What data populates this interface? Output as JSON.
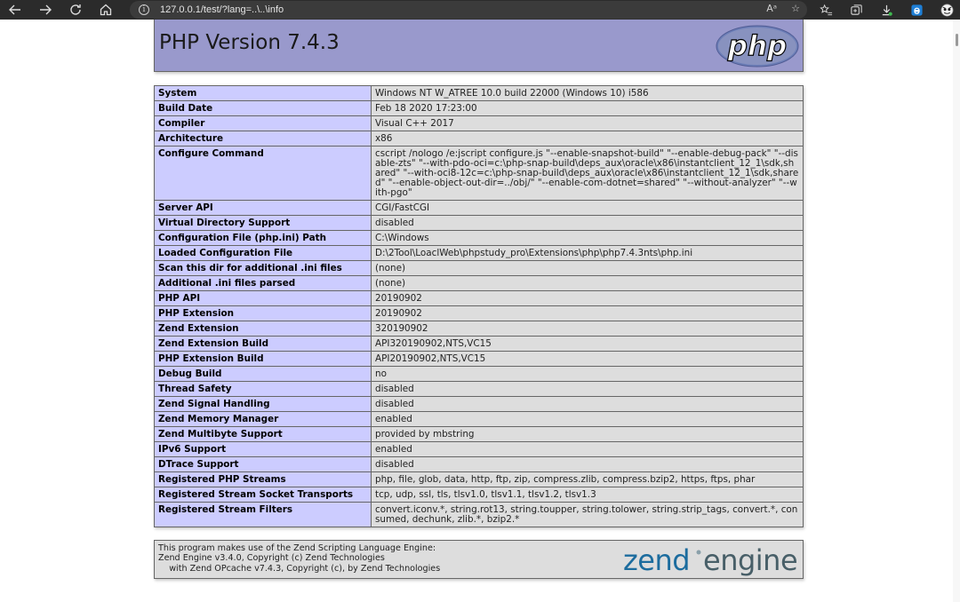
{
  "browser": {
    "url": "127.0.0.1/test/?lang=..\\..\\info",
    "read_aloud_label": "Aᵃ"
  },
  "header": {
    "title": "PHP Version 7.4.3",
    "logo_text": "php"
  },
  "rows": [
    {
      "label": "System",
      "value": "Windows NT W_ATREE 10.0 build 22000 (Windows 10) i586"
    },
    {
      "label": "Build Date",
      "value": "Feb 18 2020 17:23:00"
    },
    {
      "label": "Compiler",
      "value": "Visual C++ 2017"
    },
    {
      "label": "Architecture",
      "value": "x86"
    },
    {
      "label": "Configure Command",
      "value": "cscript /nologo /e:jscript configure.js \"--enable-snapshot-build\" \"--enable-debug-pack\" \"--disable-zts\" \"--with-pdo-oci=c:\\php-snap-build\\deps_aux\\oracle\\x86\\instantclient_12_1\\sdk,shared\" \"--with-oci8-12c=c:\\php-snap-build\\deps_aux\\oracle\\x86\\instantclient_12_1\\sdk,shared\" \"--enable-object-out-dir=../obj/\" \"--enable-com-dotnet=shared\" \"--without-analyzer\" \"--with-pgo\""
    },
    {
      "label": "Server API",
      "value": "CGI/FastCGI"
    },
    {
      "label": "Virtual Directory Support",
      "value": "disabled"
    },
    {
      "label": "Configuration File (php.ini) Path",
      "value": "C:\\Windows"
    },
    {
      "label": "Loaded Configuration File",
      "value": "D:\\2Tool\\LoaclWeb\\phpstudy_pro\\Extensions\\php\\php7.4.3nts\\php.ini"
    },
    {
      "label": "Scan this dir for additional .ini files",
      "value": "(none)"
    },
    {
      "label": "Additional .ini files parsed",
      "value": "(none)"
    },
    {
      "label": "PHP API",
      "value": "20190902"
    },
    {
      "label": "PHP Extension",
      "value": "20190902"
    },
    {
      "label": "Zend Extension",
      "value": "320190902"
    },
    {
      "label": "Zend Extension Build",
      "value": "API320190902,NTS,VC15"
    },
    {
      "label": "PHP Extension Build",
      "value": "API20190902,NTS,VC15"
    },
    {
      "label": "Debug Build",
      "value": "no"
    },
    {
      "label": "Thread Safety",
      "value": "disabled"
    },
    {
      "label": "Zend Signal Handling",
      "value": "disabled"
    },
    {
      "label": "Zend Memory Manager",
      "value": "enabled"
    },
    {
      "label": "Zend Multibyte Support",
      "value": "provided by mbstring"
    },
    {
      "label": "IPv6 Support",
      "value": "enabled"
    },
    {
      "label": "DTrace Support",
      "value": "disabled"
    },
    {
      "label": "Registered PHP Streams",
      "value": "php, file, glob, data, http, ftp, zip, compress.zlib, compress.bzip2, https, ftps, phar"
    },
    {
      "label": "Registered Stream Socket Transports",
      "value": "tcp, udp, ssl, tls, tlsv1.0, tlsv1.1, tlsv1.2, tlsv1.3"
    },
    {
      "label": "Registered Stream Filters",
      "value": "convert.iconv.*, string.rot13, string.toupper, string.tolower, string.strip_tags, convert.*, consumed, dechunk, zlib.*, bzip2.*"
    }
  ],
  "footer": {
    "line1": "This program makes use of the Zend Scripting Language Engine:",
    "line2": "Zend Engine v3.4.0, Copyright (c) Zend Technologies",
    "line3": "    with Zend OPcache v7.4.3, Copyright (c), by Zend Technologies",
    "logo_text_a": "zend",
    "logo_text_b": "engine"
  },
  "colors": {
    "header_bg": "#9999cc",
    "label_bg": "#ccccff",
    "value_bg": "#dddddd"
  }
}
